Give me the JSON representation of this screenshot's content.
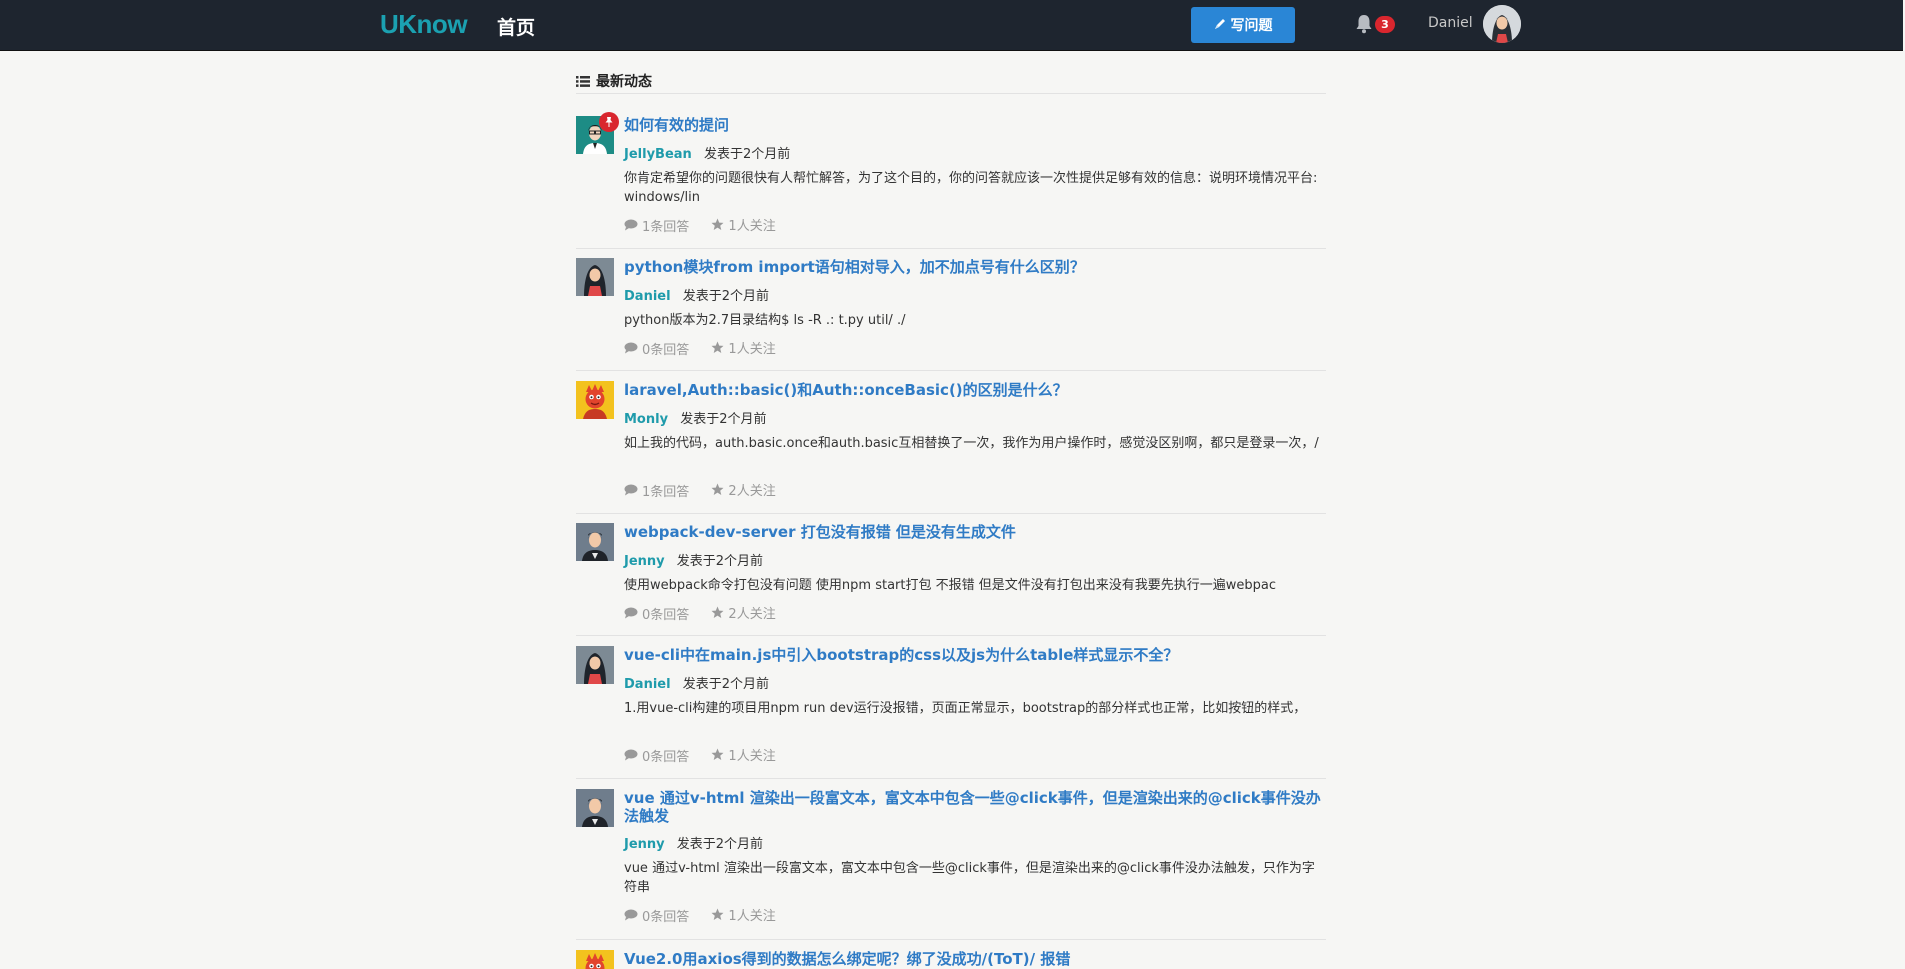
{
  "nav": {
    "brand": "UKnow",
    "home": "首页",
    "write_button": "写问题",
    "notification_count": "3",
    "username": "Daniel"
  },
  "feed": {
    "title": "最新动态",
    "items": [
      {
        "title": "如何有效的提问",
        "author": "JellyBean",
        "time": "发表于2个月前",
        "excerpt": "你肯定希望你的问题很快有人帮忙解答，为了这个目的，你的问答就应该一次性提供足够有效的信息：说明环境情况平台: windows/lin",
        "answers": "1条回答",
        "follows": "1人关注",
        "pinned": true,
        "avatar": "jellybean"
      },
      {
        "title": "python模块from import语句相对导入，加不加点号有什么区别？",
        "author": "Daniel",
        "time": "发表于2个月前",
        "excerpt": "python版本为2.7目录结构$ ls -R .: t.py  util/ ./",
        "answers": "0条回答",
        "follows": "1人关注",
        "avatar": "daniel"
      },
      {
        "title": "laravel,Auth::basic()和Auth::onceBasic()的区别是什么？",
        "author": "Monly",
        "time": "发表于2个月前",
        "excerpt": "如上我的代码，auth.basic.once和auth.basic互相替换了一次，我作为用户操作时，感觉没区别啊，都只是登录一次，/",
        "answers": "1条回答",
        "follows": "2人关注",
        "avatar": "monly"
      },
      {
        "title": "webpack-dev-server 打包没有报错 但是没有生成文件",
        "author": "Jenny",
        "time": "发表于2个月前",
        "excerpt": "使用webpack命令打包没有问题 使用npm start打包 不报错 但是文件没有打包出来没有我要先执行一遍webpac",
        "answers": "0条回答",
        "follows": "2人关注",
        "avatar": "jenny"
      },
      {
        "title": "vue-cli中在main.js中引入bootstrap的css以及js为什么table样式显示不全？",
        "author": "Daniel",
        "time": "发表于2个月前",
        "excerpt": "1.用vue-cli构建的项目用npm run dev运行没报错，页面正常显示，bootstrap的部分样式也正常，比如按钮的样式，",
        "answers": "0条回答",
        "follows": "1人关注",
        "avatar": "daniel"
      },
      {
        "title": "vue 通过v-html 渲染出一段富文本，富文本中包含一些@click事件，但是渲染出来的@click事件没办法触发",
        "author": "Jenny",
        "time": "发表于2个月前",
        "excerpt": "vue 通过v-html 渲染出一段富文本，富文本中包含一些@click事件，但是渲染出来的@click事件没办法触发，只作为字符串",
        "answers": "0条回答",
        "follows": "1人关注",
        "avatar": "jenny"
      },
      {
        "title": "Vue2.0用axios得到的数据怎么绑定呢？绑了没成功/(ToT)/ 报错",
        "avatar": "monly"
      }
    ]
  },
  "colors": {
    "navbar": "#1e252f",
    "brand": "#1ba1b1",
    "link": "#2f7bc5",
    "author": "#1f9bab",
    "button": "#2a86d6",
    "badge": "#d9262e",
    "background": "#f6f6f4"
  }
}
